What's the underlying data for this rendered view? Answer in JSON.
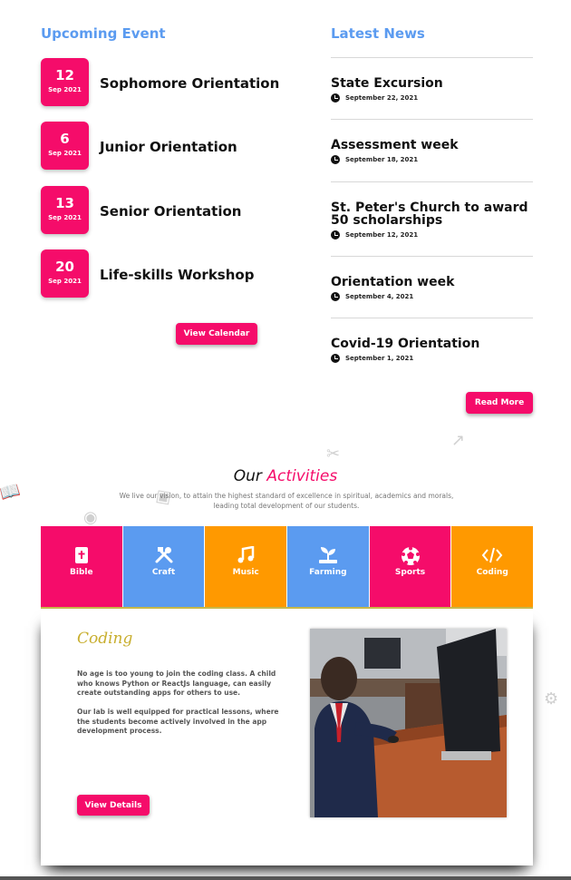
{
  "upcoming": {
    "title": "Upcoming Event",
    "events": [
      {
        "day": "12",
        "month": "Sep 2021",
        "title": "Sophomore Orientation"
      },
      {
        "day": "6",
        "month": "Sep 2021",
        "title": "Junior Orientation"
      },
      {
        "day": "13",
        "month": "Sep 2021",
        "title": "Senior Orientation"
      },
      {
        "day": "20",
        "month": "Sep 2021",
        "title": "Life-skills Workshop"
      }
    ],
    "button": "View Calendar"
  },
  "news": {
    "title": "Latest News",
    "items": [
      {
        "title": "State Excursion",
        "date": "September 22, 2021"
      },
      {
        "title": "Assessment week",
        "date": "September 18, 2021"
      },
      {
        "title": "St. Peter's Church to award 50 scholarships",
        "date": "September 12, 2021"
      },
      {
        "title": "Orientation week",
        "date": "September 4, 2021"
      },
      {
        "title": "Covid-19 Orientation",
        "date": "September 1, 2021"
      }
    ],
    "button": "Read More"
  },
  "activities": {
    "heading_our": "Our",
    "heading_accent": "Activities",
    "description": "We live our vision, to attain the highest standard of excellence in spiritual, academics and morals, leading total development of our students.",
    "tiles": [
      {
        "label": "Bible",
        "color": "#f50c6a",
        "icon": "bible-icon"
      },
      {
        "label": "Craft",
        "color": "#5b9bf0",
        "icon": "tools-icon"
      },
      {
        "label": "Music",
        "color": "#ff9900",
        "icon": "music-note-icon"
      },
      {
        "label": "Farming",
        "color": "#5b9bf0",
        "icon": "seedling-icon"
      },
      {
        "label": "Sports",
        "color": "#f50c6a",
        "icon": "soccer-ball-icon"
      },
      {
        "label": "Coding",
        "color": "#ff9900",
        "icon": "code-icon"
      }
    ],
    "detail": {
      "title": "Coding",
      "paragraph1": "No age is too young to join the coding class. A child who knows Python or ReactJs language, can easily create outstanding apps for others to use.",
      "paragraph2": "Our lab is well equipped for practical lessons, where the students become actively involved in the app development process.",
      "button": "View Details"
    }
  },
  "colors": {
    "accent": "#f50c6a",
    "blue": "#5b9bf0",
    "orange": "#ff9900",
    "gold": "#c8ae2e"
  }
}
